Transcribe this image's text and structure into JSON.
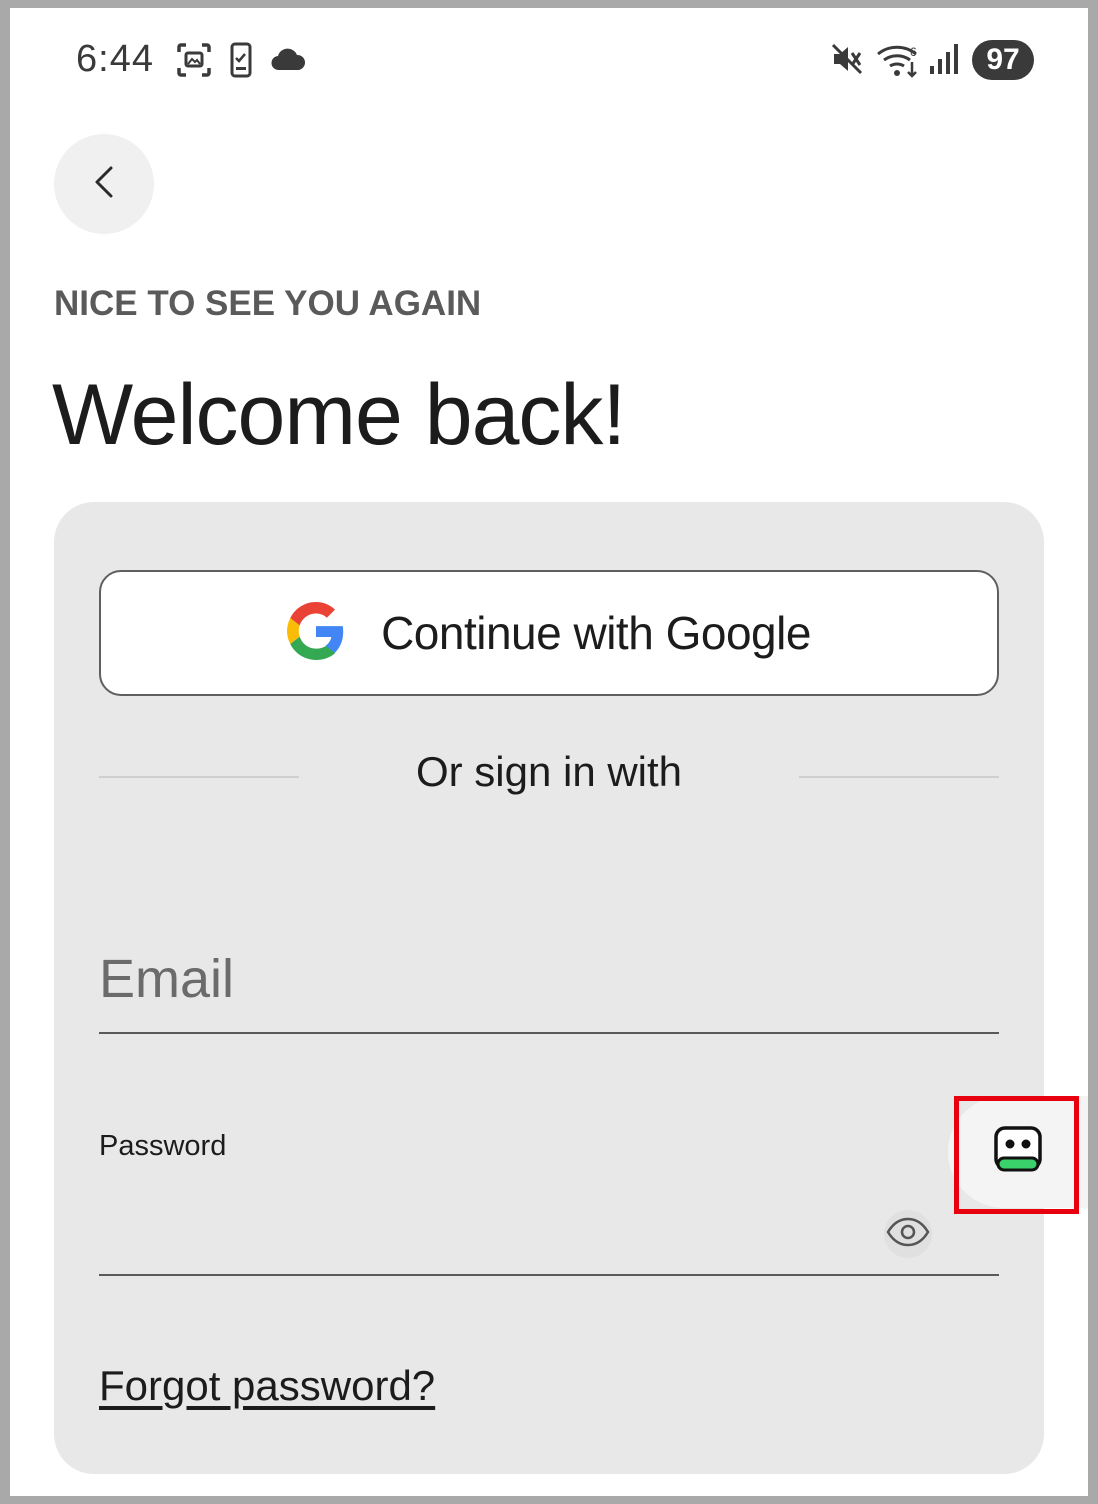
{
  "status_bar": {
    "time": "6:44",
    "battery": "97",
    "icons": [
      "screenshot-icon",
      "phone-check-icon",
      "cloud-icon",
      "mute-icon",
      "wifi-icon",
      "signal-icon"
    ]
  },
  "header": {
    "eyebrow": "NICE TO SEE YOU AGAIN",
    "title": "Welcome back!"
  },
  "auth_card": {
    "google_button_label": "Continue with Google",
    "divider_text": "Or sign in with",
    "email_placeholder": "Email",
    "password_label": "Password",
    "forgot_password": "Forgot password?"
  },
  "colors": {
    "card_bg": "#e8e8e8",
    "highlight": "#e8000e",
    "bot_accent": "#3ad16a"
  }
}
